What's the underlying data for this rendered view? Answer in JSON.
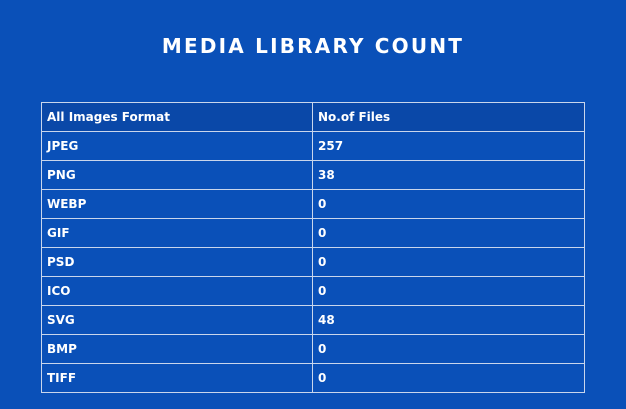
{
  "page": {
    "title": "MEDIA LIBRARY COUNT"
  },
  "table": {
    "headers": [
      "All Images Format",
      "No.of Files"
    ],
    "rows": [
      {
        "format": "JPEG",
        "count": "257"
      },
      {
        "format": "PNG",
        "count": "38"
      },
      {
        "format": "WEBP",
        "count": "0"
      },
      {
        "format": "GIF",
        "count": "0"
      },
      {
        "format": "PSD",
        "count": "0"
      },
      {
        "format": "ICO",
        "count": "0"
      },
      {
        "format": "SVG",
        "count": "48"
      },
      {
        "format": "BMP",
        "count": "0"
      },
      {
        "format": "TIFF",
        "count": "0"
      }
    ]
  },
  "colors": {
    "background": "#0a50b8",
    "header_background": "#0a48a8",
    "border": "#c9d6ec",
    "text": "#ffffff"
  }
}
